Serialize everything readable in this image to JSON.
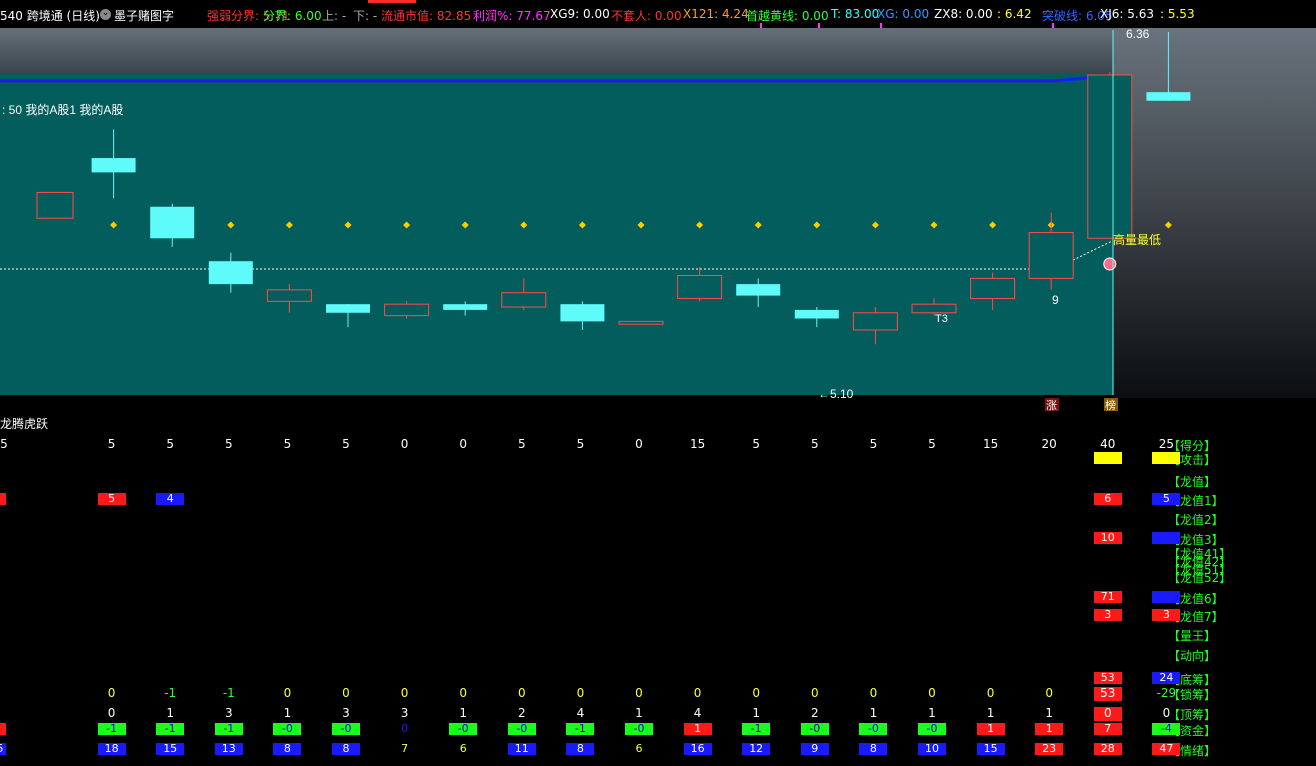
{
  "header": {
    "items": [
      {
        "text": "540 跨境通 (日线)",
        "color": "#ffffff"
      },
      {
        "text": "墨子赌图字",
        "color": "#ffffff",
        "icon": "chevron-down-icon"
      },
      {
        "text": "强弱分界: 5.71",
        "color": "#ff3333"
      },
      {
        "text": "分界: 6.00",
        "color": "#33ff33"
      },
      {
        "text": "上: -",
        "color": "#aaaaaa"
      },
      {
        "text": "下: -",
        "color": "#aaaaaa"
      },
      {
        "text": "流通市值: 82.85",
        "color": "#ff3333"
      },
      {
        "text": "利润%: 77.67",
        "color": "#ff33ff"
      },
      {
        "text": "XG9: 0.00",
        "color": "#ffffff"
      },
      {
        "text": "不套人: 0.00",
        "color": "#ff3333"
      },
      {
        "text": "X121: 4.24",
        "color": "#ff9933"
      },
      {
        "text": "首越黄线: 0.00",
        "color": "#33ff33"
      },
      {
        "text": "T: 83.00",
        "color": "#33ffff"
      },
      {
        "text": "XG: 0.00",
        "color": "#3399ff"
      },
      {
        "text": "ZX8: 0.00",
        "color": "#ffffff"
      },
      {
        "text": ": 6.42",
        "color": "#ffff33"
      },
      {
        "text": "突破线: 6.05",
        "color": "#3366ff"
      },
      {
        "text": "XJ6: 5.63",
        "color": "#ffffff"
      },
      {
        "text": ": 5.53",
        "color": "#ffff33"
      }
    ]
  },
  "main": {
    "legend_text": ": 50 我的A股1 我的A股",
    "high_label": "6.36",
    "low_label": "←5.10",
    "annotation": "高量最低",
    "t3_label": "T3",
    "nine_label": "9",
    "badge_zhang": "涨",
    "badge_bang": "榜",
    "colors": {
      "panel": "#035d5d",
      "bull": "#ff4b4b",
      "bear": "#5ffbfb",
      "ma": "#1a1aff"
    }
  },
  "chart_data": {
    "type": "candlestick",
    "candles": [
      {
        "o": 5.8,
        "h": 5.8,
        "l": 5.71,
        "c": 5.71,
        "dir": "bull"
      },
      {
        "o": 5.92,
        "h": 6.02,
        "l": 5.78,
        "c": 5.87,
        "dir": "bear"
      },
      {
        "o": 5.75,
        "h": 5.76,
        "l": 5.61,
        "c": 5.64,
        "dir": "bear"
      },
      {
        "o": 5.56,
        "h": 5.59,
        "l": 5.45,
        "c": 5.48,
        "dir": "bear"
      },
      {
        "o": 5.42,
        "h": 5.48,
        "l": 5.38,
        "c": 5.46,
        "dir": "bull"
      },
      {
        "o": 5.41,
        "h": 5.41,
        "l": 5.33,
        "c": 5.38,
        "dir": "bear"
      },
      {
        "o": 5.37,
        "h": 5.42,
        "l": 5.36,
        "c": 5.41,
        "dir": "bull"
      },
      {
        "o": 5.41,
        "h": 5.42,
        "l": 5.37,
        "c": 5.39,
        "dir": "bear"
      },
      {
        "o": 5.4,
        "h": 5.5,
        "l": 5.39,
        "c": 5.45,
        "dir": "bull"
      },
      {
        "o": 5.41,
        "h": 5.42,
        "l": 5.32,
        "c": 5.35,
        "dir": "bear"
      },
      {
        "o": 5.34,
        "h": 5.35,
        "l": 5.34,
        "c": 5.35,
        "dir": "bull"
      },
      {
        "o": 5.43,
        "h": 5.54,
        "l": 5.42,
        "c": 5.51,
        "dir": "bull"
      },
      {
        "o": 5.48,
        "h": 5.5,
        "l": 5.4,
        "c": 5.44,
        "dir": "bear"
      },
      {
        "o": 5.39,
        "h": 5.4,
        "l": 5.33,
        "c": 5.36,
        "dir": "bear"
      },
      {
        "o": 5.32,
        "h": 5.4,
        "l": 5.27,
        "c": 5.38,
        "dir": "bull"
      },
      {
        "o": 5.38,
        "h": 5.43,
        "l": 5.37,
        "c": 5.41,
        "dir": "bull"
      },
      {
        "o": 5.43,
        "h": 5.52,
        "l": 5.39,
        "c": 5.5,
        "dir": "bull"
      },
      {
        "o": 5.5,
        "h": 5.73,
        "l": 5.46,
        "c": 5.66,
        "dir": "bull"
      },
      {
        "o": 5.64,
        "h": 6.22,
        "l": 5.64,
        "c": 6.21,
        "dir": "bull"
      },
      {
        "o": 6.15,
        "h": 6.36,
        "l": 6.12,
        "c": 6.12,
        "dir": "bear"
      }
    ],
    "dotted_line_value": 5.8,
    "ma_value": 6.19
  },
  "panel2": {
    "title": "龙腾虎跃",
    "rows": [
      {
        "label": "【得分】",
        "values": [
          "5",
          "5",
          "5",
          "5",
          "5",
          "5",
          "0",
          "0",
          "5",
          "5",
          "0",
          "15",
          "5",
          "5",
          "5",
          "5",
          "15",
          "20",
          "40",
          "25"
        ],
        "color": "#ffffff"
      },
      {
        "label": "【攻击】",
        "boxes": [
          {
            "i": 18,
            "color": "#ffff00",
            "text": ""
          },
          {
            "i": 19,
            "color": "#ffff00",
            "text": ""
          }
        ]
      },
      {
        "label": "【龙值】"
      },
      {
        "label": "【龙值1】",
        "boxes": [
          {
            "i": 0,
            "color": "#ff1a1a",
            "text": ""
          },
          {
            "i": 1,
            "color": "#ff1a1a",
            "text": "5"
          },
          {
            "i": 2,
            "color": "#1a1aff",
            "text": "4"
          },
          {
            "i": 18,
            "color": "#ff1a1a",
            "text": "6"
          },
          {
            "i": 19,
            "color": "#1a1aff",
            "text": "5"
          }
        ]
      },
      {
        "label": "【龙值2】"
      },
      {
        "label": "【龙值3】",
        "boxes": [
          {
            "i": 18,
            "color": "#ff1a1a",
            "text": "10"
          },
          {
            "i": 19,
            "color": "#1a1aff",
            "text": ""
          }
        ]
      },
      {
        "label": "【龙值41】"
      },
      {
        "label": "【龙值42】"
      },
      {
        "label": "【龙值51】"
      },
      {
        "label": "【龙值52】"
      },
      {
        "label": "【龙值6】",
        "boxes": [
          {
            "i": 18,
            "color": "#ff1a1a",
            "text": "71"
          },
          {
            "i": 19,
            "color": "#1a1aff",
            "text": ""
          }
        ]
      },
      {
        "label": "【龙值7】",
        "boxes": [
          {
            "i": 18,
            "color": "#ff1a1a",
            "text": "3"
          },
          {
            "i": 19,
            "color": "#ff1a1a",
            "text": "3"
          }
        ]
      },
      {
        "label": "【量王】"
      },
      {
        "label": "【动向】"
      },
      {
        "label": "【底筹】",
        "boxes": [
          {
            "i": 18,
            "color": "#ff1a1a",
            "text": "53"
          },
          {
            "i": 19,
            "color": "#1a1aff",
            "text": "24"
          }
        ]
      },
      {
        "label": "【锁筹】",
        "values": [
          "",
          "0",
          "-1",
          "-1",
          "0",
          "0",
          "0",
          "0",
          "0",
          "0",
          "0",
          "0",
          "0",
          "0",
          "0",
          "0",
          "0",
          "0",
          "53",
          "-29"
        ],
        "colors": [
          "#ffff33",
          "#ffff33",
          "#33ff33",
          "#33ff33",
          "#ffff33",
          "#ffff33",
          "#ffff33",
          "#ffff33",
          "#ffff33",
          "#ffff33",
          "#ffff33",
          "#ffff33",
          "#ffff33",
          "#ffff33",
          "#ffff33",
          "#ffff33",
          "#ffff33",
          "#ffff33",
          "#ffffff",
          "#33ff33"
        ],
        "box18": "#ff1a1a"
      },
      {
        "label": "【顶筹】",
        "values": [
          "",
          "0",
          "1",
          "3",
          "1",
          "3",
          "3",
          "1",
          "2",
          "4",
          "1",
          "4",
          "1",
          "2",
          "1",
          "1",
          "1",
          "1",
          "0",
          "0"
        ],
        "color": "#ffffff",
        "box18": "#ff1a1a"
      },
      {
        "label": "【资金】",
        "boxes": [
          {
            "i": 0,
            "color": "#ff1a1a",
            "text": ""
          },
          {
            "i": 1,
            "color": "#1aff1a",
            "text": "-1"
          },
          {
            "i": 2,
            "color": "#1aff1a",
            "text": "-1"
          },
          {
            "i": 3,
            "color": "#1aff1a",
            "text": "-1"
          },
          {
            "i": 4,
            "color": "#1aff1a",
            "text": "-0"
          },
          {
            "i": 5,
            "color": "#1aff1a",
            "text": "-0"
          },
          {
            "i": 6,
            "color": "#000000",
            "text": "0"
          },
          {
            "i": 7,
            "color": "#1aff1a",
            "text": "-0"
          },
          {
            "i": 8,
            "color": "#1aff1a",
            "text": "-0"
          },
          {
            "i": 9,
            "color": "#1aff1a",
            "text": "-1"
          },
          {
            "i": 10,
            "color": "#1aff1a",
            "text": "-0"
          },
          {
            "i": 11,
            "color": "#ff1a1a",
            "text": "1"
          },
          {
            "i": 12,
            "color": "#1aff1a",
            "text": "-1"
          },
          {
            "i": 13,
            "color": "#1aff1a",
            "text": "-0"
          },
          {
            "i": 14,
            "color": "#1aff1a",
            "text": "-0"
          },
          {
            "i": 15,
            "color": "#1aff1a",
            "text": "-0"
          },
          {
            "i": 16,
            "color": "#ff1a1a",
            "text": "1"
          },
          {
            "i": 17,
            "color": "#ff1a1a",
            "text": "1"
          },
          {
            "i": 18,
            "color": "#ff1a1a",
            "text": "7"
          },
          {
            "i": 19,
            "color": "#1aff1a",
            "text": "-4"
          }
        ]
      },
      {
        "label": "【情绪】",
        "boxes": [
          {
            "i": 0,
            "color": "#1a1aff",
            "text": "5"
          },
          {
            "i": 1,
            "color": "#1a1aff",
            "text": "18"
          },
          {
            "i": 2,
            "color": "#1a1aff",
            "text": "15"
          },
          {
            "i": 3,
            "color": "#1a1aff",
            "text": "13"
          },
          {
            "i": 4,
            "color": "#1a1aff",
            "text": "8"
          },
          {
            "i": 5,
            "color": "#1a1aff",
            "text": "8"
          },
          {
            "i": 6,
            "color": "#000000",
            "text": "7"
          },
          {
            "i": 7,
            "color": "#000000",
            "text": "6"
          },
          {
            "i": 8,
            "color": "#1a1aff",
            "text": "11"
          },
          {
            "i": 9,
            "color": "#1a1aff",
            "text": "8"
          },
          {
            "i": 10,
            "color": "#000000",
            "text": "6"
          },
          {
            "i": 11,
            "color": "#1a1aff",
            "text": "16"
          },
          {
            "i": 12,
            "color": "#1a1aff",
            "text": "12"
          },
          {
            "i": 13,
            "color": "#1a1aff",
            "text": "9"
          },
          {
            "i": 14,
            "color": "#1a1aff",
            "text": "8"
          },
          {
            "i": 15,
            "color": "#1a1aff",
            "text": "10"
          },
          {
            "i": 16,
            "color": "#1a1aff",
            "text": "15"
          },
          {
            "i": 17,
            "color": "#ff1a1a",
            "text": "23"
          },
          {
            "i": 18,
            "color": "#ff1a1a",
            "text": "28"
          },
          {
            "i": 19,
            "color": "#ff1a1a",
            "text": "47"
          }
        ]
      }
    ]
  }
}
